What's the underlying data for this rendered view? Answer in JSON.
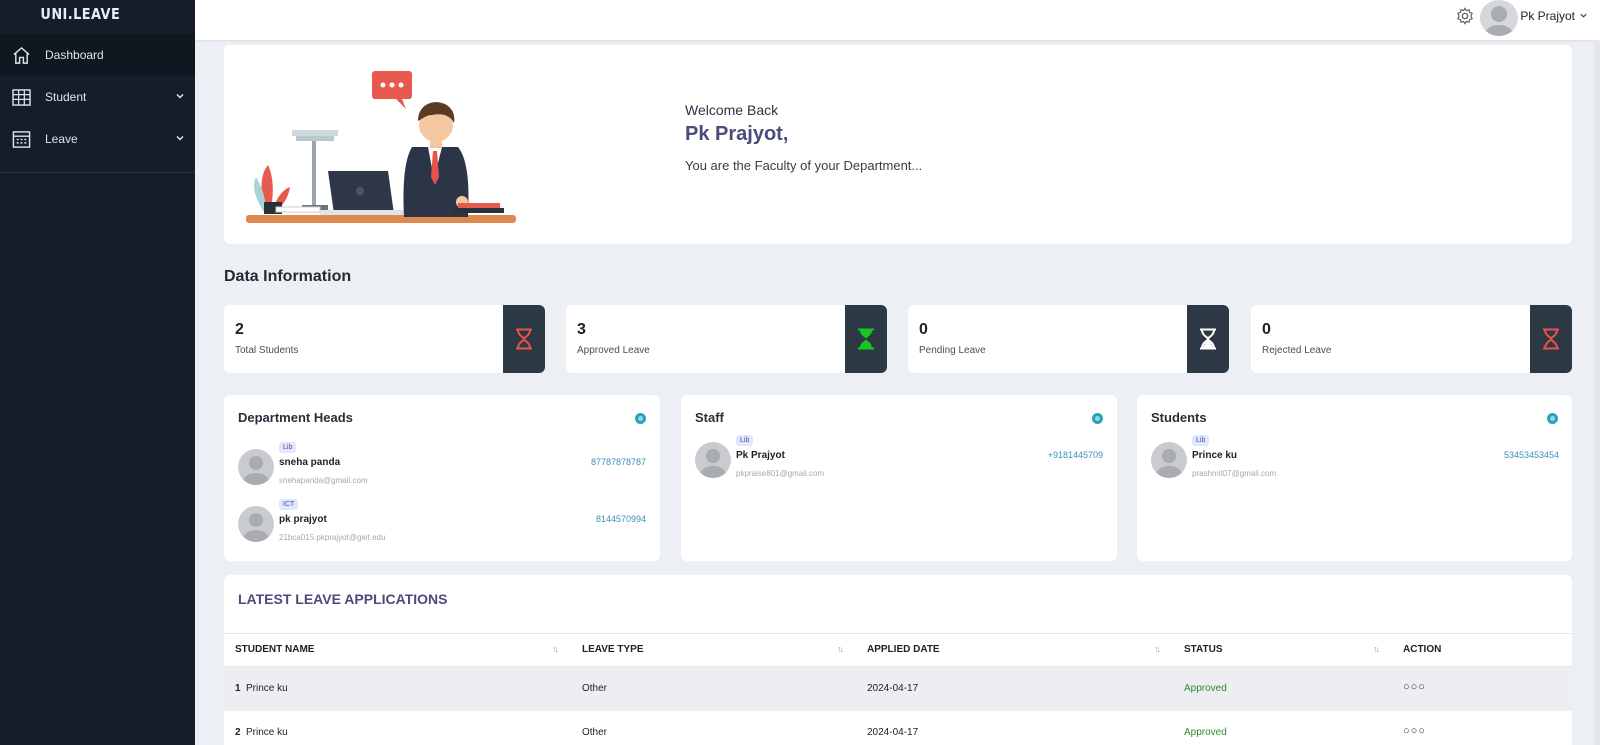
{
  "app": {
    "logo": "UNI.LEAVE"
  },
  "sidebar": {
    "items": [
      {
        "label": "Dashboard",
        "icon": "home-icon"
      },
      {
        "label": "Student",
        "icon": "grid-icon"
      },
      {
        "label": "Leave",
        "icon": "calendar-icon"
      }
    ]
  },
  "topbar": {
    "user_name": "Pk Prajyot"
  },
  "welcome": {
    "greeting": "Welcome Back",
    "name": "Pk Prajyot,",
    "subtitle": "You are the Faculty of your Department..."
  },
  "data_info": {
    "title": "Data Information",
    "stats": [
      {
        "value": "2",
        "label": "Total Students",
        "icon_color": "#e8524a"
      },
      {
        "value": "3",
        "label": "Approved Leave",
        "icon_color": "#18c724"
      },
      {
        "value": "0",
        "label": "Pending Leave",
        "icon_color": "#ffffff"
      },
      {
        "value": "0",
        "label": "Rejected Leave",
        "icon_color": "#e8524a"
      }
    ]
  },
  "lists": {
    "heads": {
      "title": "Department Heads",
      "people": [
        {
          "badge": "Lib",
          "name": "sneha panda",
          "email": "snehapanda@gmail.com",
          "phone": "87787878787"
        },
        {
          "badge": "ICT",
          "name": "pk prajyot",
          "email": "21bca015.pkprajyot@giet.edu",
          "phone": "8144570994"
        }
      ]
    },
    "staff": {
      "title": "Staff",
      "people": [
        {
          "badge": "Lib",
          "name": "Pk Prajyot",
          "email": "pkpraise801@gmail.com",
          "phone": "+9181445709"
        }
      ]
    },
    "students": {
      "title": "Students",
      "people": [
        {
          "badge": "Lib",
          "name": "Prince ku",
          "email": "prashmit07@gmail.com",
          "phone": "53453453454"
        }
      ]
    }
  },
  "leave_table": {
    "title": "LATEST LEAVE APPLICATIONS",
    "headers": [
      "STUDENT NAME",
      "LEAVE TYPE",
      "APPLIED DATE",
      "STATUS",
      "ACTION"
    ],
    "rows": [
      {
        "index": "1",
        "name": "Prince ku",
        "type": "Other",
        "date": "2024-04-17",
        "status": "Approved"
      },
      {
        "index": "2",
        "name": "Prince ku",
        "type": "Other",
        "date": "2024-04-17",
        "status": "Approved"
      }
    ]
  }
}
